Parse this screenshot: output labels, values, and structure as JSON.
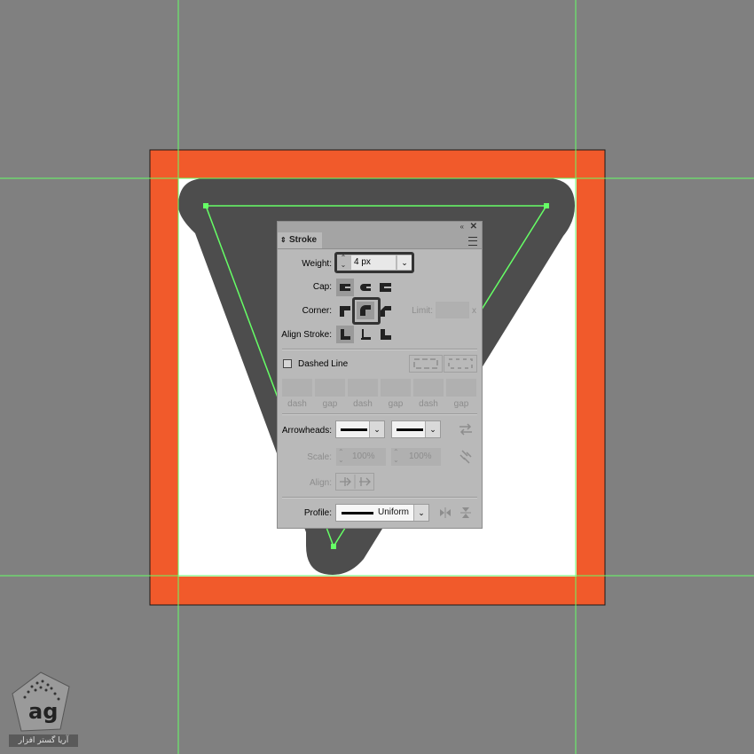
{
  "colors": {
    "workspace": "#808080",
    "artboard_frame": "#f15a2b",
    "artboard_fill": "#ffffff",
    "shape_fill": "#4d4d4d",
    "guide": "#66ff66",
    "panel_bg": "#b9b9b9",
    "highlight": "#333333"
  },
  "icons": {
    "collapse": "«",
    "close": "✕",
    "tab_toggle": "⇕",
    "spin": "⌃⌄",
    "dropdown": "⌄"
  },
  "panel": {
    "tab_title": "Stroke",
    "weight": {
      "label": "Weight:",
      "value": "4 px"
    },
    "cap": {
      "label": "Cap:",
      "options": [
        "butt-cap",
        "round-cap",
        "projecting-cap"
      ],
      "selected": "butt-cap"
    },
    "corner": {
      "label": "Corner:",
      "options": [
        "miter-join",
        "round-join",
        "bevel-join"
      ],
      "selected": "round-join",
      "limit_label": "Limit:",
      "limit_suffix": "x"
    },
    "align_stroke": {
      "label": "Align Stroke:",
      "options": [
        "align-center",
        "align-inside",
        "align-outside"
      ],
      "selected": "align-center"
    },
    "dashed_line": {
      "label": "Dashed Line",
      "checked": false
    },
    "dash_gap_labels": [
      "dash",
      "gap",
      "dash",
      "gap",
      "dash",
      "gap"
    ],
    "arrowheads": {
      "label": "Arrowheads:"
    },
    "scale": {
      "label": "Scale:",
      "start": "100%",
      "end": "100%"
    },
    "align": {
      "label": "Align:"
    },
    "profile": {
      "label": "Profile:",
      "value": "Uniform"
    }
  },
  "watermark": {
    "text": "آریا گستر افزار"
  }
}
